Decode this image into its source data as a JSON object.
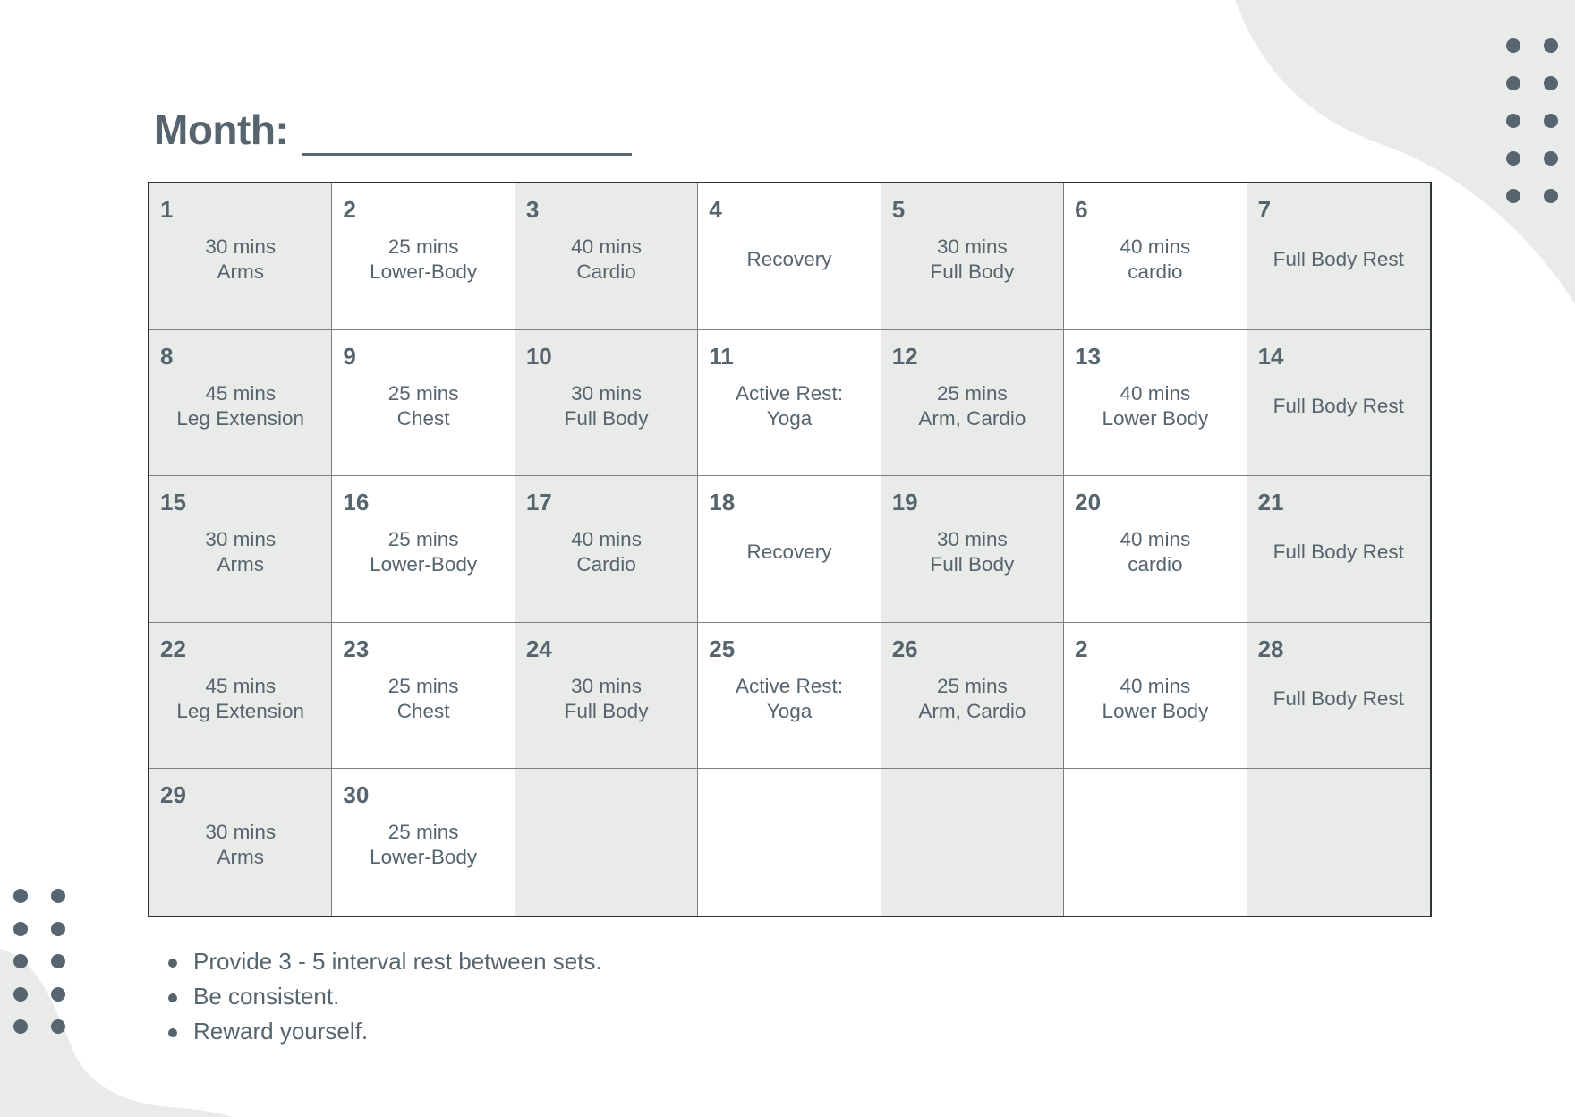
{
  "header": {
    "title": "Month:",
    "month_value": ""
  },
  "calendar": {
    "cells": [
      {
        "day": "1",
        "lines": [
          "30 mins",
          "Arms"
        ]
      },
      {
        "day": "2",
        "lines": [
          "25 mins",
          "Lower-Body"
        ]
      },
      {
        "day": "3",
        "lines": [
          "40 mins",
          "Cardio"
        ]
      },
      {
        "day": "4",
        "lines": [
          "Recovery"
        ]
      },
      {
        "day": "5",
        "lines": [
          "30 mins",
          "Full Body"
        ]
      },
      {
        "day": "6",
        "lines": [
          "40 mins",
          "cardio"
        ]
      },
      {
        "day": "7",
        "lines": [
          "Full Body Rest"
        ]
      },
      {
        "day": "8",
        "lines": [
          "45 mins",
          "Leg Extension"
        ]
      },
      {
        "day": "9",
        "lines": [
          "25 mins",
          "Chest"
        ]
      },
      {
        "day": "10",
        "lines": [
          "30 mins",
          "Full Body"
        ]
      },
      {
        "day": "11",
        "lines": [
          "Active Rest:",
          "Yoga"
        ]
      },
      {
        "day": "12",
        "lines": [
          "25 mins",
          "Arm, Cardio"
        ]
      },
      {
        "day": "13",
        "lines": [
          "40 mins",
          "Lower Body"
        ]
      },
      {
        "day": "14",
        "lines": [
          "Full Body Rest"
        ]
      },
      {
        "day": "15",
        "lines": [
          "30 mins",
          "Arms"
        ]
      },
      {
        "day": "16",
        "lines": [
          "25 mins",
          "Lower-Body"
        ]
      },
      {
        "day": "17",
        "lines": [
          "40 mins",
          "Cardio"
        ]
      },
      {
        "day": "18",
        "lines": [
          "Recovery"
        ]
      },
      {
        "day": "19",
        "lines": [
          "30 mins",
          "Full Body"
        ]
      },
      {
        "day": "20",
        "lines": [
          "40 mins",
          "cardio"
        ]
      },
      {
        "day": "21",
        "lines": [
          "Full Body Rest"
        ]
      },
      {
        "day": "22",
        "lines": [
          "45 mins",
          "Leg Extension"
        ]
      },
      {
        "day": "23",
        "lines": [
          "25 mins",
          "Chest"
        ]
      },
      {
        "day": "24",
        "lines": [
          "30 mins",
          "Full Body"
        ]
      },
      {
        "day": "25",
        "lines": [
          "Active Rest:",
          "Yoga"
        ]
      },
      {
        "day": "26",
        "lines": [
          "25 mins",
          "Arm, Cardio"
        ]
      },
      {
        "day": "2",
        "lines": [
          "40 mins",
          "Lower Body"
        ]
      },
      {
        "day": "28",
        "lines": [
          "Full Body Rest"
        ]
      },
      {
        "day": "29",
        "lines": [
          "30 mins",
          "Arms"
        ]
      },
      {
        "day": "30",
        "lines": [
          "25 mins",
          "Lower-Body"
        ]
      },
      {
        "day": "",
        "lines": []
      },
      {
        "day": "",
        "lines": []
      },
      {
        "day": "",
        "lines": []
      },
      {
        "day": "",
        "lines": []
      },
      {
        "day": "",
        "lines": []
      }
    ]
  },
  "notes": [
    "Provide 3 - 5 interval rest between sets.",
    "Be consistent.",
    "Reward yourself."
  ],
  "colors": {
    "text": "#56646e",
    "shade": "#e9ebe8",
    "border": "#2f3336",
    "decor_dots": "#56656f",
    "decor_blob": "#e9ebe8"
  }
}
